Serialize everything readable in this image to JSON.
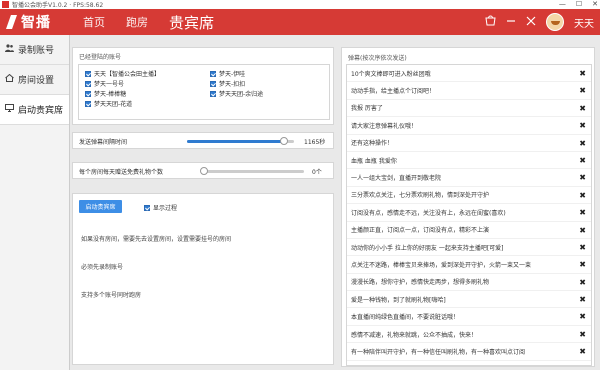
{
  "window": {
    "title": "智播公会助手V1.0.2 · FPS:58.62",
    "controls": [
      "—",
      "☐",
      "✕"
    ]
  },
  "header": {
    "logo_text": "智播",
    "nav": [
      {
        "label": "首页",
        "active": false
      },
      {
        "label": "跑房",
        "active": false
      },
      {
        "label": "贵宾席",
        "active": true
      }
    ],
    "username": "天天",
    "icons": [
      "shop-icon",
      "minimize-icon",
      "close-icon"
    ]
  },
  "sidebar": {
    "items": [
      {
        "label": "录制账号",
        "icon": "users-icon"
      },
      {
        "label": "房间设置",
        "icon": "home-icon"
      },
      {
        "label": "启动贵宾席",
        "icon": "monitor-icon",
        "active": true
      }
    ]
  },
  "accounts": {
    "title": "已经登陆的账号",
    "list": [
      "天天【智播公会田主播】",
      "梦天-伊哇",
      "梦天一号号",
      "梦天-扣扣",
      "梦天-棒棒糖",
      "梦天天团-余归途",
      "梦天天团-花道"
    ]
  },
  "interval": {
    "label": "发送弹幕间隔时间",
    "value_text": "1165秒",
    "fraction": 0.91
  },
  "gift": {
    "label": "每个房间每天赠送免费礼物个数",
    "value_text": "0个",
    "fraction": 0.0
  },
  "control": {
    "start_label": "启动贵宾席",
    "show_process_label": "显示过程",
    "show_process_checked": true,
    "info": [
      "如果没有房间，需要先去设置房间，设置需要挂号的房间",
      "必须先录制账号",
      "支持多个账号同时跑房"
    ]
  },
  "danmu": {
    "title": "弹幕(按次序依次发送)",
    "messages": [
      "10个爽文棒即可进入粉丝团哦",
      "动动手指，给主播点个订阅吧！",
      "我报 厉害了",
      "请大家注意弹幕礼仪哦！",
      "还有这种操作！",
      "血瓶 血瓶 我爱你",
      "一人一组大宝剑，直播开到敬老院",
      "三分票欢点关注，七分票欢刷礼物，情到深处开守护",
      "订阅没有点，感情走不远，关注没有上，永远在闺蜜(喜欢)",
      "主播颜正直，订阅点一点，订阅没有点，精彩不上演",
      "动动你的小小手 拉上你的好朋友 一起来支持主播吧[可爱]",
      "点关注不迷路，棒棒宝贝来捧场，爱到深处开守护，火箭一束又一束",
      "漫漫长路，想你守护，感情快走两步，想得多刷礼物",
      "爱是一种钱物，到了就刷礼物[嗨哈]",
      "本直播间纯绿色直播间，不要说脏话哦！",
      "感情不减速，礼物来就跳，公众不抽成，快来！",
      "有一种陪伴叫开守护，有一种信任叫刷礼物，有一种喜欢叫点订阅"
    ]
  }
}
